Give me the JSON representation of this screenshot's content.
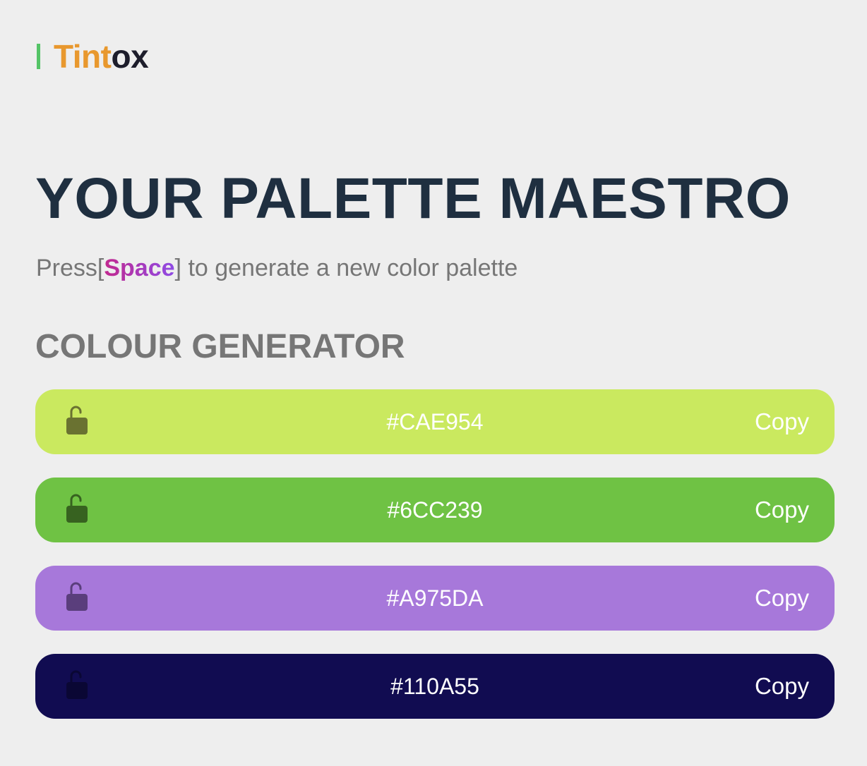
{
  "logo": {
    "accent_text": "Tint",
    "rest_text": "ox",
    "accent_color": "#e8982e",
    "bar_color": "#54c466"
  },
  "hero": {
    "title": "YOUR PALETTE MAESTRO",
    "subtitle_prefix": "Press[",
    "subtitle_key": "Space",
    "subtitle_suffix": "] to generate a new color palette"
  },
  "generator": {
    "section_title": "COLOUR GENERATOR",
    "swatches": [
      {
        "hex": "#CAE954",
        "bg": "#cae95f",
        "lock_color": "#6a7231",
        "lock_icon": "unlocked-lock-icon",
        "copy_label": "Copy"
      },
      {
        "hex": "#6CC239",
        "bg": "#6fc244",
        "lock_color": "#376220",
        "lock_icon": "unlocked-lock-icon",
        "copy_label": "Copy"
      },
      {
        "hex": "#A975DA",
        "bg": "#a778da",
        "lock_color": "#5a3e7c",
        "lock_icon": "unlocked-lock-icon",
        "copy_label": "Copy"
      },
      {
        "hex": "#110A55",
        "bg": "#110c51",
        "lock_color": "#0a0734",
        "lock_icon": "unlocked-lock-icon",
        "copy_label": "Copy"
      }
    ]
  }
}
